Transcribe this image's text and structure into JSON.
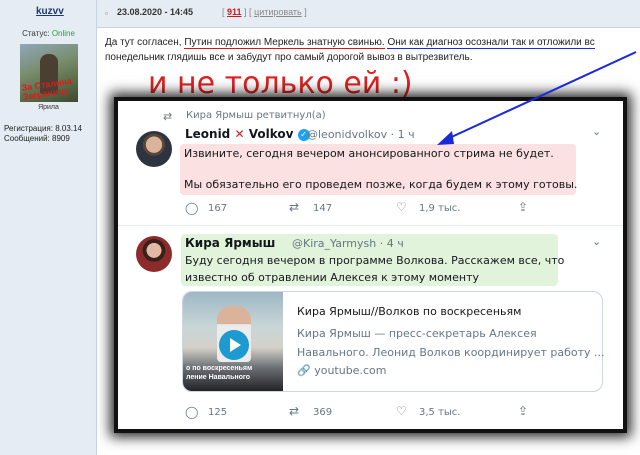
{
  "forum": {
    "username": "kuzvv",
    "status_label": "Статус:",
    "status_value": "Online",
    "avatar_overlay_text": "За Сталина Заграницу",
    "avatar_caption": "Ярила",
    "registration": "Регистрация: 8.03.14",
    "messages": "Сообщений: 8909",
    "post_date": "23.08.2020 - 14:45",
    "post_number": "911",
    "quote_label": "цитировать",
    "post_text_prefix": "Да тут согласен, ",
    "post_text_red": "Путин подложил Меркель знатную свинью.",
    "post_text_blue": "Они как диагноз осознали так и отложили вс",
    "post_text_line2": "понедельник глядишь все и забудут про самый дорогой вывоз в вытрезвитель.",
    "big_caption": "и не только ей :)",
    "colors": {
      "accent_red": "#e02020",
      "link_blue": "#1a2ad6",
      "online_green": "#2aa43a"
    }
  },
  "tweet1": {
    "retweet_label": "Кира Ярмыш ретвитнул(а)",
    "name_part1": "Leonid",
    "cross": "✕",
    "name_part2": "Volkov",
    "handle": "@leonidvolkov · 1 ч",
    "text_line1": "Извините, сегодня вечером анонсированного стрима не будет.",
    "text_line2": "Мы обязательно его проведем позже, когда будем к этому готовы.",
    "replies": "167",
    "retweets": "147",
    "likes": "1,9 тыс."
  },
  "tweet2": {
    "name": "Кира Ярмыш",
    "handle": "@Kira_Yarmysh · 4 ч",
    "text_line1": "Буду сегодня вечером в программе Волкова. Расскажем все, что",
    "text_line2": "известно об отравлении Алексея к этому моменту",
    "card_thumb_text": "о по воскресеньям\nление Навального",
    "card_title": "Кира Ярмыш//Волков по воскресеньям",
    "card_desc_line1": "Кира Ярмыш — пресс-секретарь Алексея",
    "card_desc_line2": "Навального. Леонид Волков координирует работу ...",
    "card_link": "youtube.com",
    "replies": "125",
    "retweets": "369",
    "likes": "3,5 тыс."
  }
}
